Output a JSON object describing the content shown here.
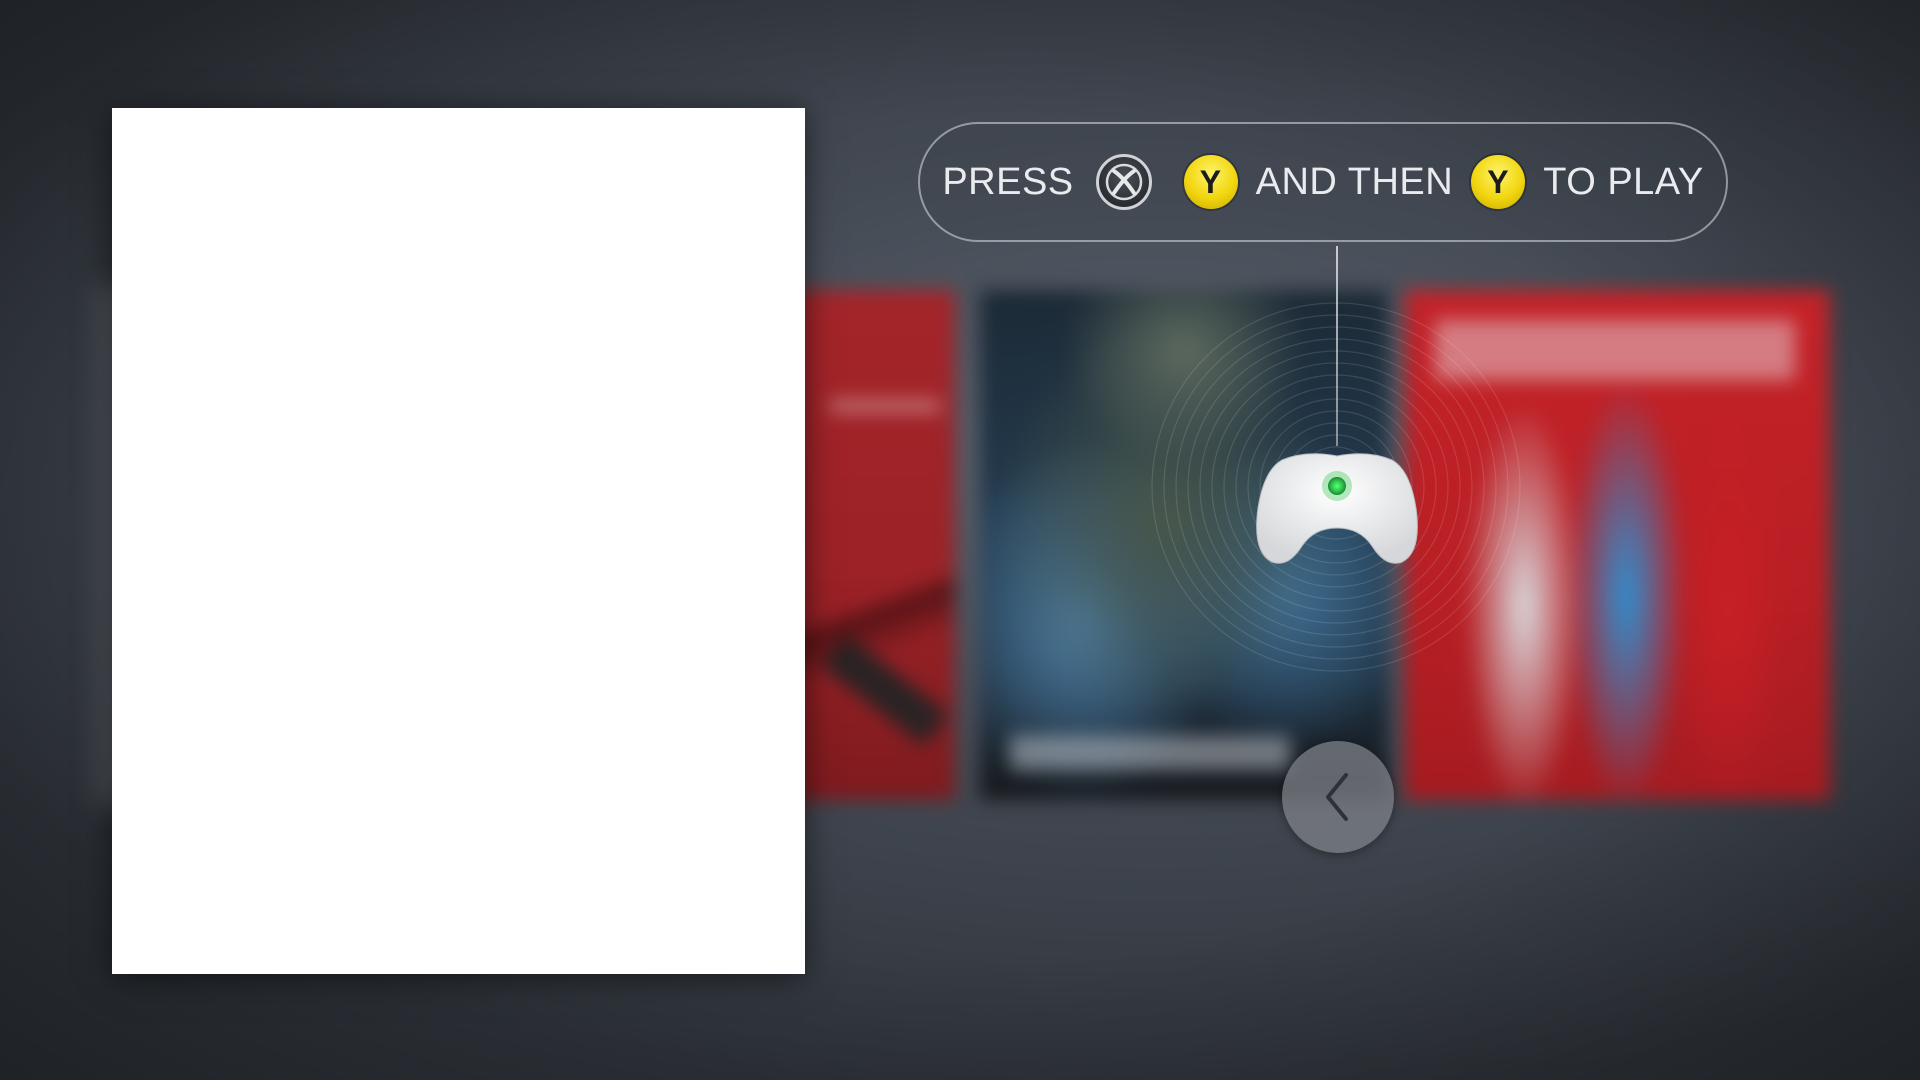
{
  "instruction": {
    "press": "PRESS",
    "and_then": "AND THEN",
    "to_play": "TO PLAY",
    "first_y": "Y",
    "second_y": "Y",
    "guide_icon": "xbox-guide-icon"
  },
  "controller": {
    "icon": "controller-icon",
    "status_light_color": "#2ec24a"
  },
  "navigation": {
    "back_icon": "chevron-left-icon"
  },
  "carousel": {
    "covers": [
      "red-cover",
      "halo-cover",
      "nba-cover"
    ]
  },
  "colors": {
    "y_button": "#f1d60f",
    "accent_green": "#2ec24a"
  }
}
